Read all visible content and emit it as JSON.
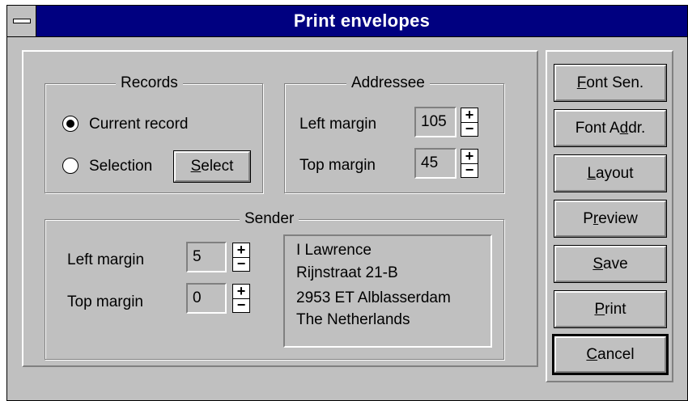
{
  "window": {
    "title": "Print envelopes"
  },
  "records": {
    "group_label": "Records",
    "current_label": "Current record",
    "selection_label": "Selection",
    "select_button": "Select",
    "current_checked": true
  },
  "addressee": {
    "group_label": "Addressee",
    "left_label": "Left margin",
    "left_value": "105",
    "top_label": "Top margin",
    "top_value": "45"
  },
  "sender": {
    "group_label": "Sender",
    "left_label": "Left margin",
    "left_value": "5",
    "top_label": "Top margin",
    "top_value": "0",
    "address_lines": [
      "I Lawrence",
      "Rijnstraat 21-B",
      "2953 ET Alblasserdam",
      "The Netherlands"
    ]
  },
  "spinner": {
    "plus": "+",
    "minus": "−"
  },
  "buttons": [
    {
      "label": "Font Sen.",
      "mnemonic": "F"
    },
    {
      "label": "Font Addr.",
      "mnemonic": "d"
    },
    {
      "label": "Layout",
      "mnemonic": "L"
    },
    {
      "label": "Preview",
      "mnemonic": "r"
    },
    {
      "label": "Save",
      "mnemonic": "S"
    },
    {
      "label": "Print",
      "mnemonic": "P"
    },
    {
      "label": "Cancel",
      "mnemonic": "C"
    }
  ]
}
